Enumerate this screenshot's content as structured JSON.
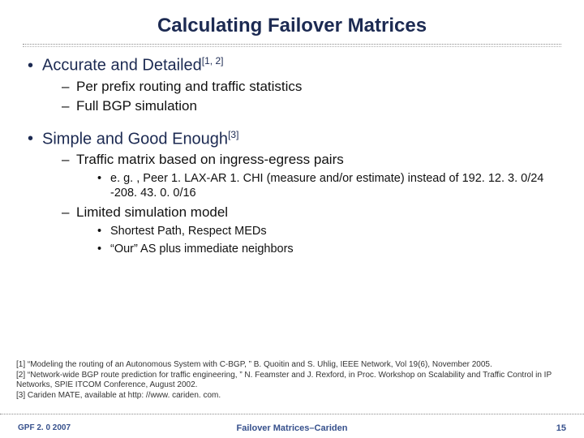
{
  "title": "Calculating Failover Matrices",
  "bullets": {
    "b1a_text": "Accurate and Detailed",
    "b1a_sup": "[1, 2]",
    "b2a": "Per prefix routing and traffic statistics",
    "b2b": "Full BGP simulation",
    "b1b_text": "Simple and Good Enough",
    "b1b_sup": "[3]",
    "b2c": "Traffic matrix based on ingress-egress pairs",
    "b3a": "e. g. , Peer 1. LAX-AR 1. CHI (measure and/or estimate) instead of 192. 12. 3. 0/24 -208. 43. 0. 0/16",
    "b2d": "Limited simulation model",
    "b3b": "Shortest Path, Respect MEDs",
    "b3c": "“Our” AS plus immediate neighbors"
  },
  "refs": {
    "r1": "[1] “Modeling the routing of an Autonomous System with C-BGP, ” B. Quoitin and S. Uhlig, IEEE Network, Vol 19(6), November 2005.",
    "r2": "[2] “Network-wide BGP route prediction for traffic engineering, ” N. Feamster and J. Rexford, in Proc. Workshop on Scalability and Traffic Control in IP Networks, SPIE ITCOM Conference, August 2002.",
    "r3": "[3] Cariden MATE, available at http: //www. cariden. com."
  },
  "footer": {
    "left": "GPF 2. 0 2007",
    "center": "Failover Matrices–Cariden",
    "right": "15"
  },
  "glyphs": {
    "bullet": "•",
    "dash": "–"
  }
}
